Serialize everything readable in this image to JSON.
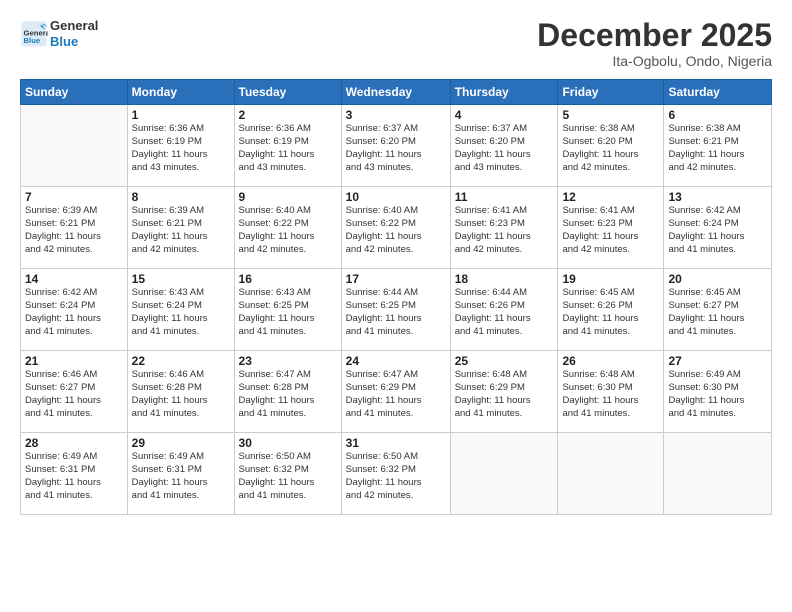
{
  "logo": {
    "text_general": "General",
    "text_blue": "Blue"
  },
  "header": {
    "month": "December 2025",
    "location": "Ita-Ogbolu, Ondo, Nigeria"
  },
  "days_of_week": [
    "Sunday",
    "Monday",
    "Tuesday",
    "Wednesday",
    "Thursday",
    "Friday",
    "Saturday"
  ],
  "weeks": [
    [
      {
        "day": "",
        "info": ""
      },
      {
        "day": "1",
        "info": "Sunrise: 6:36 AM\nSunset: 6:19 PM\nDaylight: 11 hours\nand 43 minutes."
      },
      {
        "day": "2",
        "info": "Sunrise: 6:36 AM\nSunset: 6:19 PM\nDaylight: 11 hours\nand 43 minutes."
      },
      {
        "day": "3",
        "info": "Sunrise: 6:37 AM\nSunset: 6:20 PM\nDaylight: 11 hours\nand 43 minutes."
      },
      {
        "day": "4",
        "info": "Sunrise: 6:37 AM\nSunset: 6:20 PM\nDaylight: 11 hours\nand 43 minutes."
      },
      {
        "day": "5",
        "info": "Sunrise: 6:38 AM\nSunset: 6:20 PM\nDaylight: 11 hours\nand 42 minutes."
      },
      {
        "day": "6",
        "info": "Sunrise: 6:38 AM\nSunset: 6:21 PM\nDaylight: 11 hours\nand 42 minutes."
      }
    ],
    [
      {
        "day": "7",
        "info": "Sunrise: 6:39 AM\nSunset: 6:21 PM\nDaylight: 11 hours\nand 42 minutes."
      },
      {
        "day": "8",
        "info": "Sunrise: 6:39 AM\nSunset: 6:21 PM\nDaylight: 11 hours\nand 42 minutes."
      },
      {
        "day": "9",
        "info": "Sunrise: 6:40 AM\nSunset: 6:22 PM\nDaylight: 11 hours\nand 42 minutes."
      },
      {
        "day": "10",
        "info": "Sunrise: 6:40 AM\nSunset: 6:22 PM\nDaylight: 11 hours\nand 42 minutes."
      },
      {
        "day": "11",
        "info": "Sunrise: 6:41 AM\nSunset: 6:23 PM\nDaylight: 11 hours\nand 42 minutes."
      },
      {
        "day": "12",
        "info": "Sunrise: 6:41 AM\nSunset: 6:23 PM\nDaylight: 11 hours\nand 42 minutes."
      },
      {
        "day": "13",
        "info": "Sunrise: 6:42 AM\nSunset: 6:24 PM\nDaylight: 11 hours\nand 41 minutes."
      }
    ],
    [
      {
        "day": "14",
        "info": "Sunrise: 6:42 AM\nSunset: 6:24 PM\nDaylight: 11 hours\nand 41 minutes."
      },
      {
        "day": "15",
        "info": "Sunrise: 6:43 AM\nSunset: 6:24 PM\nDaylight: 11 hours\nand 41 minutes."
      },
      {
        "day": "16",
        "info": "Sunrise: 6:43 AM\nSunset: 6:25 PM\nDaylight: 11 hours\nand 41 minutes."
      },
      {
        "day": "17",
        "info": "Sunrise: 6:44 AM\nSunset: 6:25 PM\nDaylight: 11 hours\nand 41 minutes."
      },
      {
        "day": "18",
        "info": "Sunrise: 6:44 AM\nSunset: 6:26 PM\nDaylight: 11 hours\nand 41 minutes."
      },
      {
        "day": "19",
        "info": "Sunrise: 6:45 AM\nSunset: 6:26 PM\nDaylight: 11 hours\nand 41 minutes."
      },
      {
        "day": "20",
        "info": "Sunrise: 6:45 AM\nSunset: 6:27 PM\nDaylight: 11 hours\nand 41 minutes."
      }
    ],
    [
      {
        "day": "21",
        "info": "Sunrise: 6:46 AM\nSunset: 6:27 PM\nDaylight: 11 hours\nand 41 minutes."
      },
      {
        "day": "22",
        "info": "Sunrise: 6:46 AM\nSunset: 6:28 PM\nDaylight: 11 hours\nand 41 minutes."
      },
      {
        "day": "23",
        "info": "Sunrise: 6:47 AM\nSunset: 6:28 PM\nDaylight: 11 hours\nand 41 minutes."
      },
      {
        "day": "24",
        "info": "Sunrise: 6:47 AM\nSunset: 6:29 PM\nDaylight: 11 hours\nand 41 minutes."
      },
      {
        "day": "25",
        "info": "Sunrise: 6:48 AM\nSunset: 6:29 PM\nDaylight: 11 hours\nand 41 minutes."
      },
      {
        "day": "26",
        "info": "Sunrise: 6:48 AM\nSunset: 6:30 PM\nDaylight: 11 hours\nand 41 minutes."
      },
      {
        "day": "27",
        "info": "Sunrise: 6:49 AM\nSunset: 6:30 PM\nDaylight: 11 hours\nand 41 minutes."
      }
    ],
    [
      {
        "day": "28",
        "info": "Sunrise: 6:49 AM\nSunset: 6:31 PM\nDaylight: 11 hours\nand 41 minutes."
      },
      {
        "day": "29",
        "info": "Sunrise: 6:49 AM\nSunset: 6:31 PM\nDaylight: 11 hours\nand 41 minutes."
      },
      {
        "day": "30",
        "info": "Sunrise: 6:50 AM\nSunset: 6:32 PM\nDaylight: 11 hours\nand 41 minutes."
      },
      {
        "day": "31",
        "info": "Sunrise: 6:50 AM\nSunset: 6:32 PM\nDaylight: 11 hours\nand 42 minutes."
      },
      {
        "day": "",
        "info": ""
      },
      {
        "day": "",
        "info": ""
      },
      {
        "day": "",
        "info": ""
      }
    ]
  ]
}
